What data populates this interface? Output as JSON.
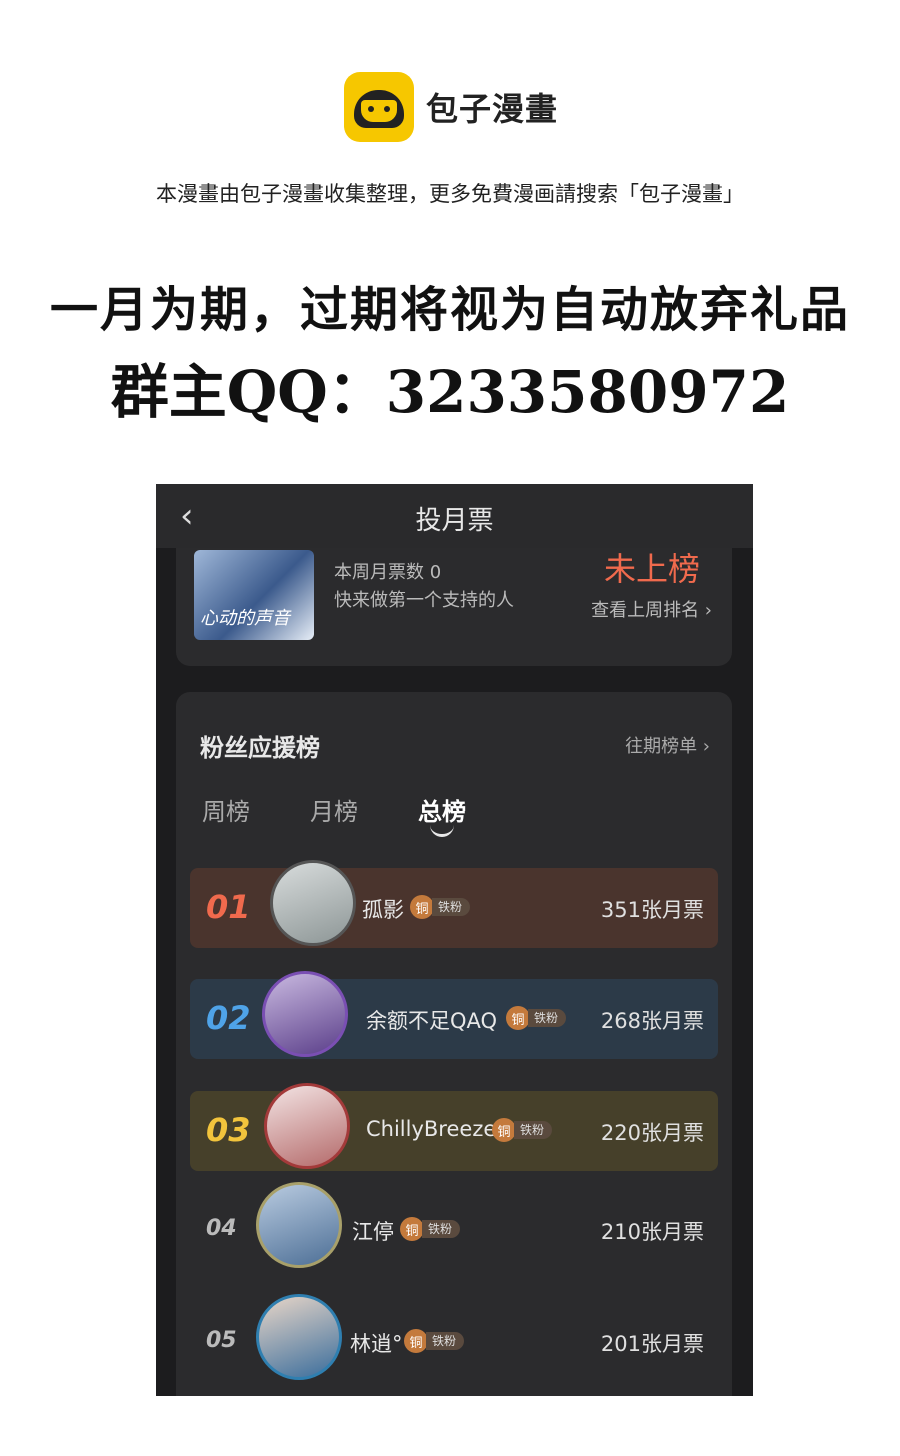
{
  "header": {
    "logo_icon": "bun-logo-icon",
    "brand": "包子漫畫",
    "notice": "本漫畫由包子漫畫收集整理，更多免費漫画請搜索「包子漫畫」"
  },
  "promo": {
    "line1": "一月为期，过期将视为自动放弃礼品",
    "line2": "群主QQ：3233580972"
  },
  "screen": {
    "title": "投月票",
    "back_icon": "chevron-left-icon",
    "cover_title": "心动的声音",
    "week_votes": "本周月票数 0",
    "be_first": "快来做第一个支持的人",
    "status": "未上榜",
    "last_week_link": "查看上周排名 ›",
    "fan_board_title": "粉丝应援榜",
    "history_link": "往期榜单 ›",
    "tabs": [
      "周榜",
      "月榜",
      "总榜"
    ],
    "badge_coin": "铜",
    "badge_label": "铁粉",
    "ranking": [
      {
        "rank": "01",
        "name": "孤影",
        "votes": "351张月票"
      },
      {
        "rank": "02",
        "name": "余额不足QAQ",
        "votes": "268张月票"
      },
      {
        "rank": "03",
        "name": "ChillyBreeze",
        "votes": "220张月票"
      },
      {
        "rank": "04",
        "name": "江停",
        "votes": "210张月票"
      },
      {
        "rank": "05",
        "name": "林逍°",
        "votes": "201张月票"
      }
    ]
  },
  "colors": {
    "rank1": "#f06a4d",
    "rank2": "#4fa3e8",
    "rank3": "#f2c43c"
  }
}
